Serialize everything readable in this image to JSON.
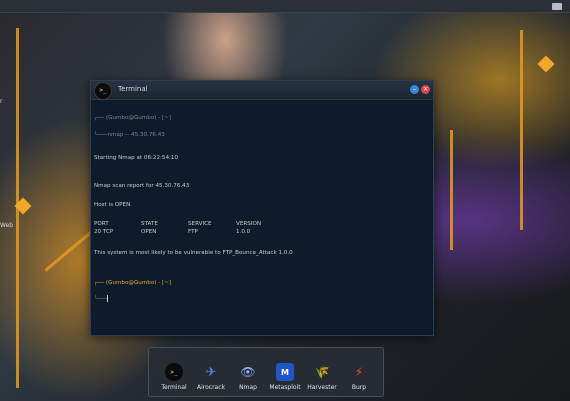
{
  "desktop": {
    "side_labels": [
      "r",
      "Web"
    ]
  },
  "terminal": {
    "title": "Terminal",
    "icon_glyph": ">_",
    "lines": {
      "prompt1": "┌── (Gumbo@Gumbo) - [~]",
      "cmd1": "└───nmap -- 45.30.76.43",
      "starting": "Starting Nmap at 06:22:54:10",
      "report": "Nmap scan report for 45.30.76.43",
      "host": "Host is OPEN.",
      "headers": {
        "port": "PORT",
        "state": "STATE",
        "service": "SERVICE",
        "version": "VERSION"
      },
      "row": {
        "port": "20 TCP",
        "state": "OPEN",
        "service": "FTP",
        "version": "1.0.0"
      },
      "vuln": "This system is most likely to be vulnerable to FTP_Bounce_Attack 1.0.0",
      "prompt2": "┌── (Gumbo@Gumbo) - [~]",
      "cmd2": "└───"
    },
    "buttons": {
      "minimize": "–",
      "close": "×"
    }
  },
  "dock": {
    "items": [
      {
        "label": "Terminal",
        "icon": "terminal-icon",
        "glyph": ">_"
      },
      {
        "label": "Airocrack",
        "icon": "aircrack-icon",
        "glyph": "✈"
      },
      {
        "label": "Nmap",
        "icon": "nmap-icon",
        "glyph": "👁"
      },
      {
        "label": "Metasploit",
        "icon": "metasploit-icon",
        "glyph": "M"
      },
      {
        "label": "Harvester",
        "icon": "harvester-icon",
        "glyph": "🌾"
      },
      {
        "label": "Burp",
        "icon": "burp-icon",
        "glyph": "⚡"
      }
    ]
  },
  "colors": {
    "terminal_bg": "#0d1b2a",
    "prompt": "#e0b02c",
    "accent": "#e59a22"
  }
}
